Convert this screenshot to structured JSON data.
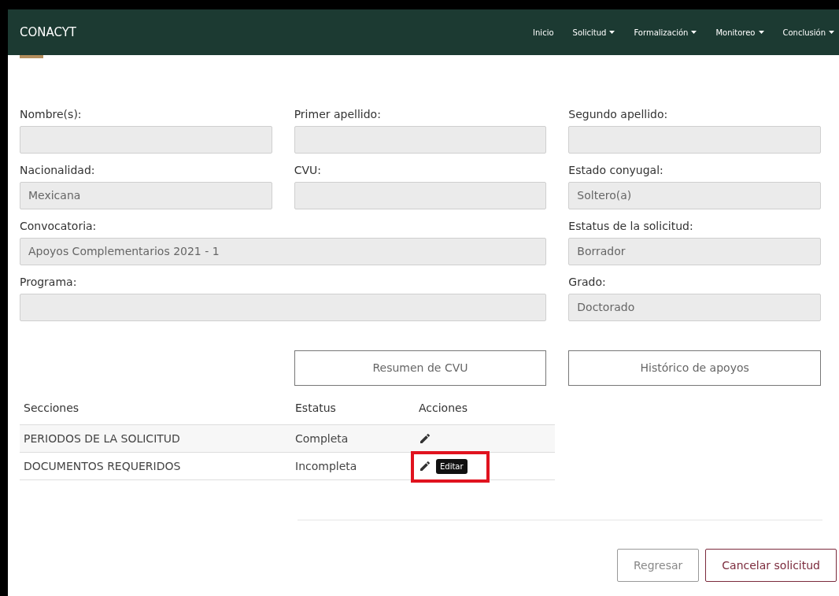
{
  "navbar": {
    "brand": "CONACYT",
    "items": [
      {
        "label": "Inicio",
        "dropdown": false
      },
      {
        "label": "Solicitud",
        "dropdown": true
      },
      {
        "label": "Formalización",
        "dropdown": true
      },
      {
        "label": "Monitoreo",
        "dropdown": true
      },
      {
        "label": "Conclusión",
        "dropdown": true
      }
    ]
  },
  "form": {
    "rows": [
      [
        {
          "label": "Nombre(s):"
        },
        {
          "label": "Primer apellido:"
        },
        {
          "label": "Segundo apellido:"
        }
      ],
      [
        {
          "label": "Nacionalidad:",
          "value": "Mexicana"
        },
        {
          "label": "CVU:"
        },
        {
          "label": "Estado conyugal:",
          "value": "Soltero(a)"
        }
      ],
      [
        {
          "label": "Convocatoria:",
          "value": "Apoyos Complementarios 2021 - 1"
        },
        {
          "label": "Estatus de la solicitud:",
          "value": "Borrador"
        }
      ],
      [
        {
          "label": "Programa:"
        },
        {
          "label": "Grado:",
          "value": "Doctorado"
        }
      ]
    ]
  },
  "summary_buttons": [
    "Resumen de CVU",
    "Histórico de apoyos"
  ],
  "sections_table": {
    "columns": [
      "Secciones",
      "Estatus",
      "Acciones"
    ],
    "rows": [
      {
        "section": "PERIODOS DE LA SOLICITUD",
        "status": "Completa",
        "highlighted": false
      },
      {
        "section": "DOCUMENTOS REQUERIDOS",
        "status": "Incompleta",
        "highlighted": true,
        "tooltip": "Editar"
      }
    ]
  },
  "footer_buttons": [
    {
      "label": "Regresar",
      "kind": "secondary"
    },
    {
      "label": "Cancelar solicitud",
      "kind": "danger"
    }
  ]
}
